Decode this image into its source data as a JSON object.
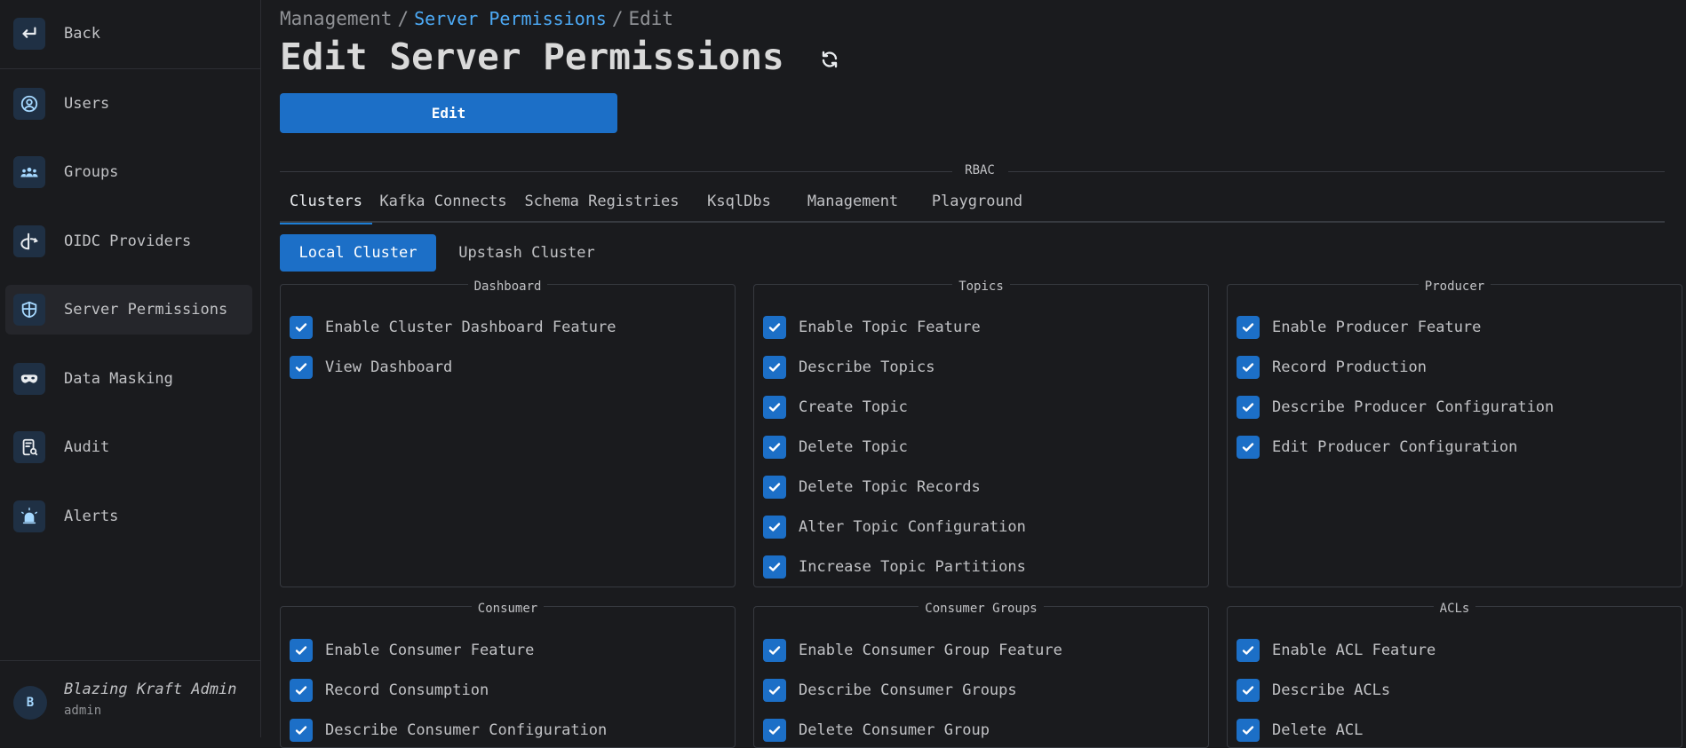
{
  "sidebar": {
    "back_label": "Back",
    "items": [
      {
        "label": "Users",
        "icon": "user-circle-icon"
      },
      {
        "label": "Groups",
        "icon": "users-group-icon"
      },
      {
        "label": "OIDC Providers",
        "icon": "openid-icon"
      },
      {
        "label": "Server Permissions",
        "icon": "shield-icon",
        "active": true
      },
      {
        "label": "Data Masking",
        "icon": "mask-icon"
      },
      {
        "label": "Audit",
        "icon": "report-icon"
      },
      {
        "label": "Alerts",
        "icon": "siren-icon"
      }
    ],
    "user": {
      "initial": "B",
      "name": "Blazing Kraft Admin",
      "role": "admin"
    }
  },
  "breadcrumb": {
    "root": "Management",
    "link": "Server Permissions",
    "current": "Edit",
    "separator": "/"
  },
  "page": {
    "title": "Edit Server Permissions",
    "edit_button": "Edit"
  },
  "rbac_label": "RBAC",
  "tabs": [
    "Clusters",
    "Kafka Connects",
    "Schema Registries",
    "KsqlDbs",
    "Management",
    "Playground"
  ],
  "active_tab": "Clusters",
  "clusters": [
    "Local Cluster",
    "Upstash Cluster"
  ],
  "active_cluster": "Local Cluster",
  "groups": [
    {
      "title": "Dashboard",
      "items": [
        "Enable Cluster Dashboard Feature",
        "View Dashboard"
      ]
    },
    {
      "title": "Topics",
      "items": [
        "Enable Topic Feature",
        "Describe Topics",
        "Create Topic",
        "Delete Topic",
        "Delete Topic Records",
        "Alter Topic Configuration",
        "Increase Topic Partitions"
      ]
    },
    {
      "title": "Producer",
      "items": [
        "Enable Producer Feature",
        "Record Production",
        "Describe Producer Configuration",
        "Edit Producer Configuration"
      ]
    },
    {
      "title": "Consumer",
      "items": [
        "Enable Consumer Feature",
        "Record Consumption",
        "Describe Consumer Configuration"
      ]
    },
    {
      "title": "Consumer Groups",
      "items": [
        "Enable Consumer Group Feature",
        "Describe Consumer Groups",
        "Delete Consumer Group"
      ]
    },
    {
      "title": "ACLs",
      "items": [
        "Enable ACL Feature",
        "Describe ACLs",
        "Delete ACL"
      ]
    }
  ],
  "colors": {
    "accent": "#1c6fc7",
    "link": "#4dabf7",
    "background": "#1a1b1e"
  }
}
